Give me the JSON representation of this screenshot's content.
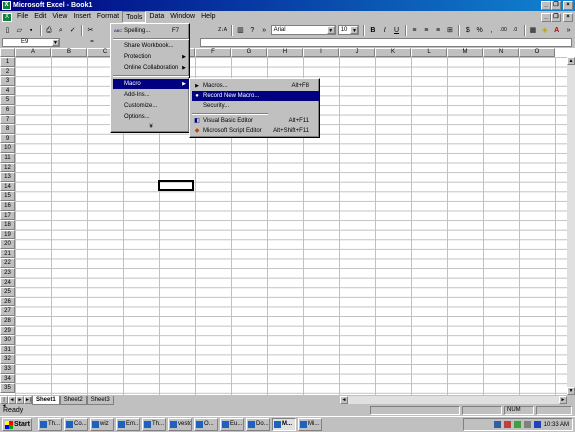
{
  "window": {
    "title": "Microsoft Excel - Book1",
    "app_icon": "X",
    "buttons": [
      "_",
      "❐",
      "×"
    ]
  },
  "menubar": {
    "doc_icon": "X",
    "items": [
      "File",
      "Edit",
      "View",
      "Insert",
      "Format",
      "Tools",
      "Data",
      "Window",
      "Help"
    ],
    "buttons": [
      "_",
      "❐",
      "×"
    ]
  },
  "toolbar": {
    "font_name": "Arial",
    "font_size": "10",
    "buttons": [
      "new",
      "open",
      "save",
      "print",
      "print-preview",
      "spelling",
      "cut"
    ],
    "format_buttons": [
      "B",
      "I",
      "U"
    ],
    "number_buttons": [
      "$",
      "%",
      ",",
      ".00",
      ".0"
    ],
    "sort_label": "Z↓A",
    "chart_label": "▥",
    "help_label": "?",
    "more_label": "»"
  },
  "formulabar": {
    "namebox": "E9",
    "equals": "="
  },
  "grid": {
    "columns": [
      "A",
      "B",
      "C",
      "D",
      "E",
      "F",
      "G",
      "H",
      "I",
      "J",
      "K",
      "L",
      "M",
      "N",
      "O"
    ],
    "rows": [
      "1",
      "2",
      "3",
      "4",
      "5",
      "6",
      "7",
      "8",
      "9",
      "10",
      "11",
      "12",
      "13",
      "14",
      "15",
      "16",
      "17",
      "18",
      "19",
      "20",
      "21",
      "22",
      "23",
      "24",
      "25",
      "26",
      "27",
      "28",
      "29",
      "30",
      "31",
      "32",
      "33",
      "34",
      "35"
    ]
  },
  "sheets": {
    "tabs": [
      "Sheet1",
      "Sheet2",
      "Sheet3"
    ],
    "active": "Sheet1",
    "nav": [
      "|◄",
      "◄",
      "►",
      "►|"
    ]
  },
  "status": {
    "text": "Ready",
    "num": "NUM"
  },
  "tools_menu": {
    "items": [
      {
        "label": "Spelling...",
        "shortcut": "F7",
        "icon": "ABC"
      },
      {
        "label": "Share Workbook..."
      },
      {
        "label": "Protection",
        "submenu": true
      },
      {
        "label": "Online Collaboration",
        "submenu": true
      },
      {
        "label": "Macro",
        "submenu": true
      },
      {
        "label": "Add-Ins..."
      },
      {
        "label": "Customize..."
      },
      {
        "label": "Options..."
      }
    ],
    "more": "¥"
  },
  "macro_menu": {
    "items": [
      {
        "label": "Macros...",
        "shortcut": "Alt+F8"
      },
      {
        "label": "Record New Macro..."
      },
      {
        "label": "Security..."
      },
      {
        "label": "Visual Basic Editor",
        "shortcut": "Alt+F11"
      },
      {
        "label": "Microsoft Script Editor",
        "shortcut": "Alt+Shift+F11"
      }
    ]
  },
  "taskbar": {
    "start": "Start",
    "buttons": [
      "Th...",
      "Co...",
      "wiz",
      "Em...",
      "Th...",
      "vesto",
      "O...",
      "Eu...",
      "Do...",
      "M...",
      "Mi..."
    ],
    "active_index": 9,
    "clock": "10:33 AM"
  },
  "colors": {
    "title_start": "#000080",
    "title_end": "#1084d0",
    "highlight": "#000080",
    "chrome": "#c0c0c0"
  }
}
